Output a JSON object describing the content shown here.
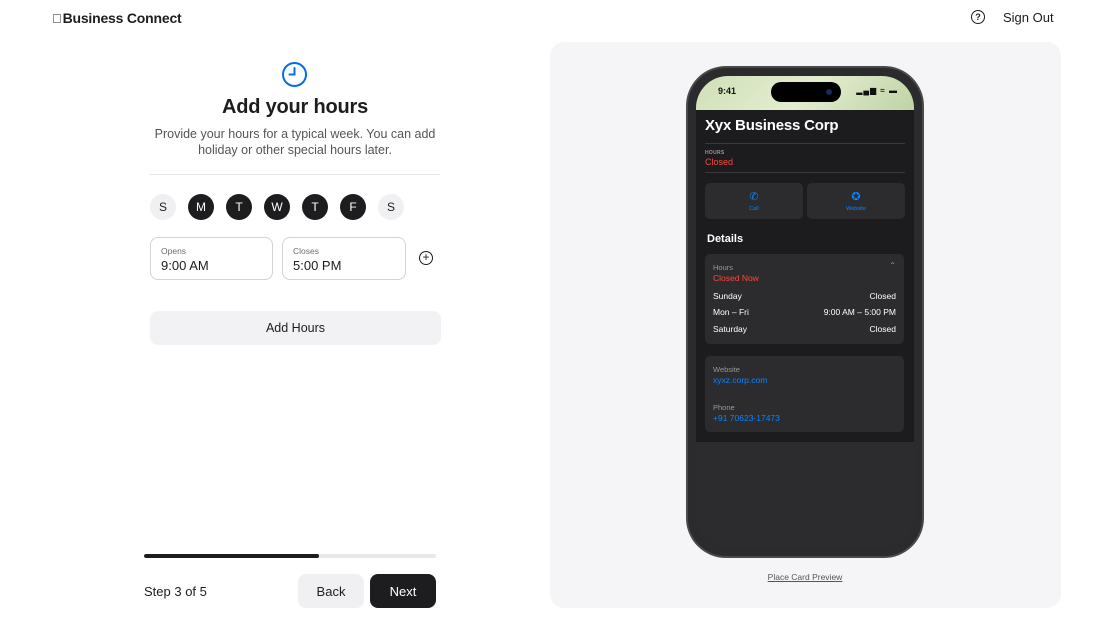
{
  "header": {
    "logo": "",
    "brand": "Business Connect",
    "help_glyph": "?",
    "sign_out": "Sign Out"
  },
  "form": {
    "icon": "clock-icon",
    "title": "Add your hours",
    "subtitle": "Provide your hours for a typical week. You can add holiday or other special hours later.",
    "days": [
      {
        "label": "S",
        "selected": false
      },
      {
        "label": "M",
        "selected": true
      },
      {
        "label": "T",
        "selected": true
      },
      {
        "label": "W",
        "selected": true
      },
      {
        "label": "T",
        "selected": true
      },
      {
        "label": "F",
        "selected": true
      },
      {
        "label": "S",
        "selected": false
      }
    ],
    "opens_label": "Opens",
    "opens_value": "9:00 AM",
    "closes_label": "Closes",
    "closes_value": "5:00 PM",
    "add_icon_glyph": "+",
    "add_hours": "Add Hours"
  },
  "footer": {
    "progress": 0.6,
    "step": "Step 3 of 5",
    "back": "Back",
    "next": "Next"
  },
  "preview": {
    "status_time": "9:41",
    "status_icons": "▂▄▆ ≈ ▬",
    "business_name": "Xyx Business Corp",
    "hours_caption": "HOURS",
    "hours_status": "Closed",
    "call_icon": "✆",
    "call_label": "Call",
    "website_icon": "✪",
    "website_label": "Website",
    "details": "Details",
    "hours_box_caption": "Hours",
    "hours_box_status": "Closed Now",
    "chevron": "⌃",
    "hours_rows": [
      {
        "day": "Sunday",
        "time": "Closed"
      },
      {
        "day": "Mon – Fri",
        "time": "9:00 AM – 5:00 PM"
      },
      {
        "day": "Saturday",
        "time": "Closed"
      }
    ],
    "website_caption": "Website",
    "website_url": "xyxz.corp.com",
    "phone_caption": "Phone",
    "phone_number": "+91 70623-17473",
    "caption": "Place Card Preview"
  },
  "colors": {
    "accent_dark": "#1d1d1f",
    "link_blue": "#0a84ff",
    "closed_red": "#ff453a",
    "clock_blue": "#0071e3"
  }
}
